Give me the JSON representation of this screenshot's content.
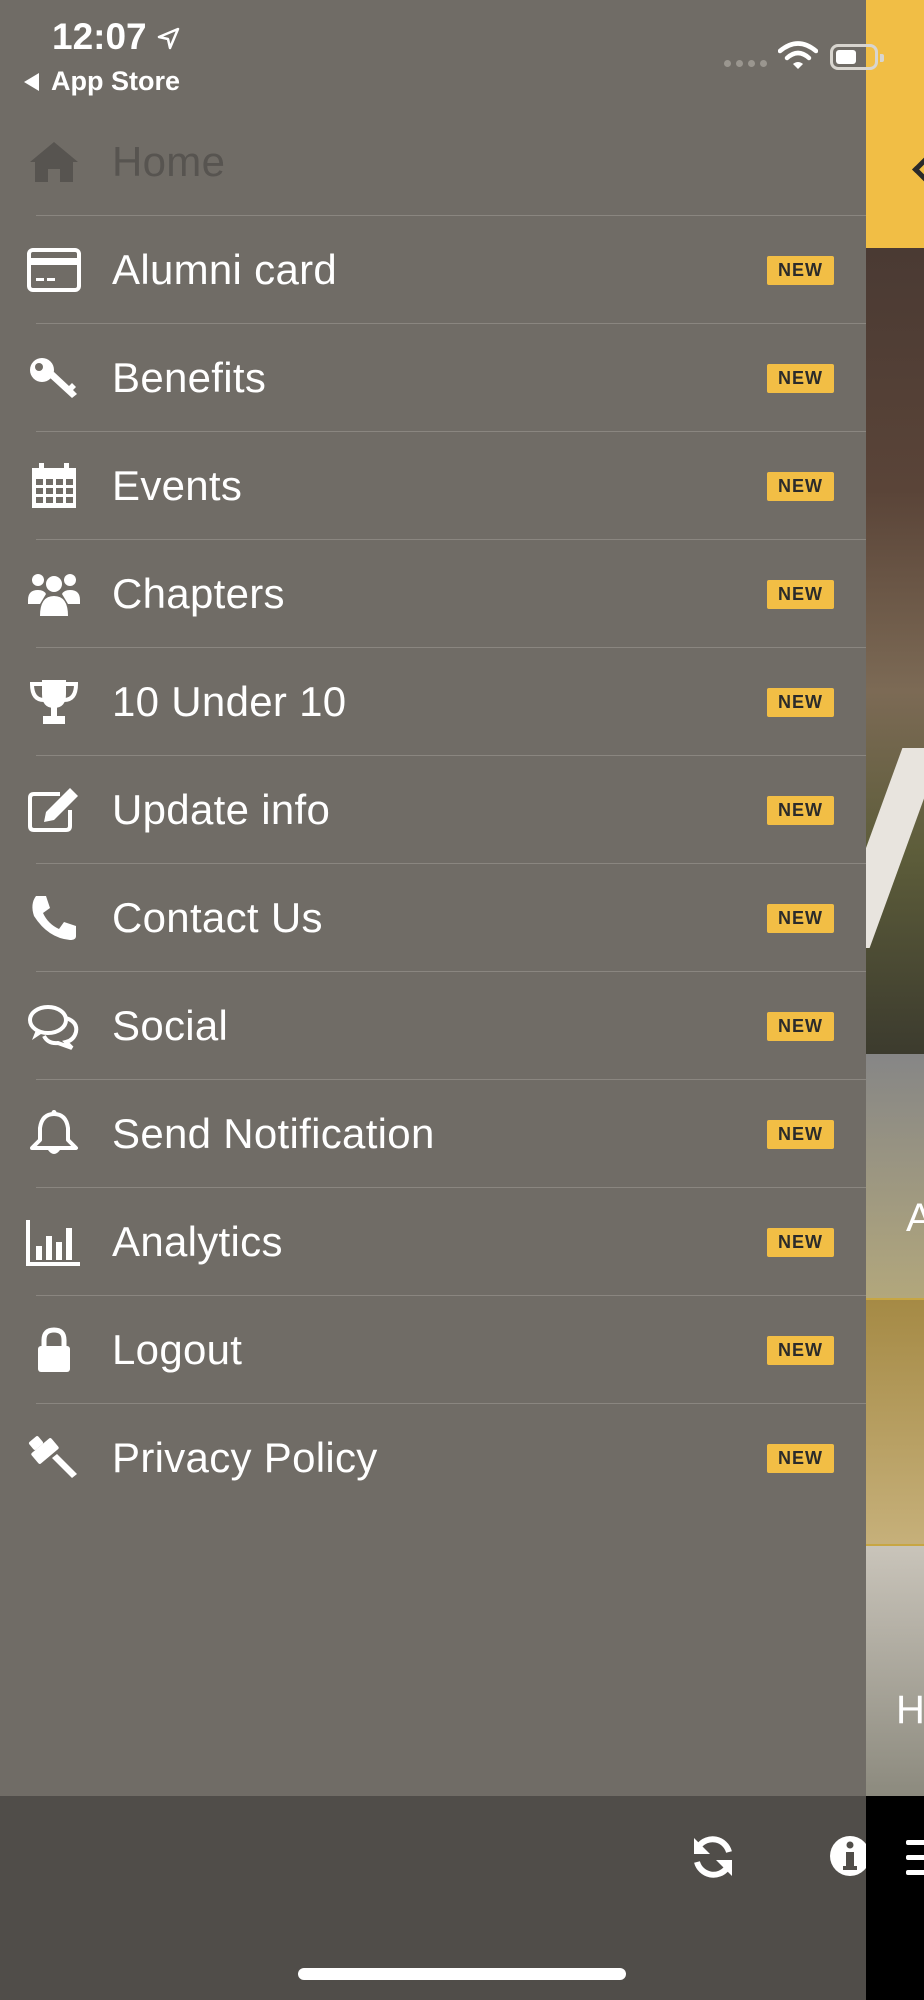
{
  "status_bar": {
    "time": "12:07",
    "back_app": "App Store"
  },
  "menu": {
    "items": [
      {
        "label": "Home",
        "icon": "home-icon",
        "badge": ""
      },
      {
        "label": "Alumni card",
        "icon": "card-icon",
        "badge": "NEW"
      },
      {
        "label": "Benefits",
        "icon": "key-icon",
        "badge": "NEW"
      },
      {
        "label": "Events",
        "icon": "calendar-icon",
        "badge": "NEW"
      },
      {
        "label": "Chapters",
        "icon": "users-icon",
        "badge": "NEW"
      },
      {
        "label": "10 Under 10",
        "icon": "trophy-icon",
        "badge": "NEW"
      },
      {
        "label": "Update info",
        "icon": "edit-icon",
        "badge": "NEW"
      },
      {
        "label": "Contact Us",
        "icon": "phone-icon",
        "badge": "NEW"
      },
      {
        "label": "Social",
        "icon": "chat-icon",
        "badge": "NEW"
      },
      {
        "label": "Send Notification",
        "icon": "bell-icon",
        "badge": "NEW"
      },
      {
        "label": "Analytics",
        "icon": "bar-chart-icon",
        "badge": "NEW"
      },
      {
        "label": "Logout",
        "icon": "lock-icon",
        "badge": "NEW"
      },
      {
        "label": "Privacy Policy",
        "icon": "gavel-icon",
        "badge": "NEW"
      }
    ]
  },
  "background_tiles": {
    "tile1_letter": "A",
    "tile3_letter": "H"
  },
  "colors": {
    "accent": "#f2be45",
    "drawer": "#706c66",
    "toolbar": "#504d49"
  }
}
